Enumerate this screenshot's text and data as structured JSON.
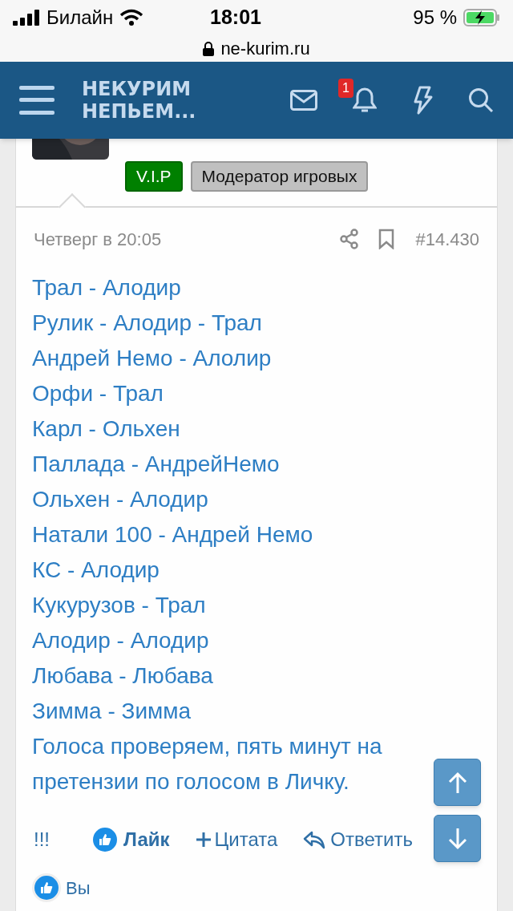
{
  "status_bar": {
    "carrier": "Билайн",
    "time": "18:01",
    "battery": "95 %",
    "url": "ne-kurim.ru"
  },
  "header": {
    "logo_lines": [
      "НЕКУРИМ",
      "НЕПЬЕМ..."
    ],
    "notifications": "1"
  },
  "author": {
    "badges": [
      {
        "label": "V.I.P",
        "color": "#008000"
      },
      {
        "label": "Модератор игровых",
        "color": "#c0c0c0"
      }
    ]
  },
  "post": {
    "date": "Четверг в 20:05",
    "number": "#14.430",
    "lines": [
      "Трал - Алодир",
      "Рулик - Алодир - Трал",
      "Андрей Немо - Алолир",
      "Орфи - Трал",
      "Карл - Ольхен",
      "Паллада - АндрейНемо",
      "Ольхен - Алодир",
      "Натали 100 - Андрей Немо",
      "КС - Алодир",
      "Кукурузов - Трал",
      "Алодир - Алодир",
      "Любава - Любава",
      "Зимма - Зимма",
      "Голоса проверяем, пять минут на претензии по голосом в Личку."
    ]
  },
  "actions": {
    "extra": "!!!",
    "like": "Лайк",
    "quote": "Цитата",
    "reply": "Ответить"
  },
  "reactions": {
    "who": "Вы"
  }
}
